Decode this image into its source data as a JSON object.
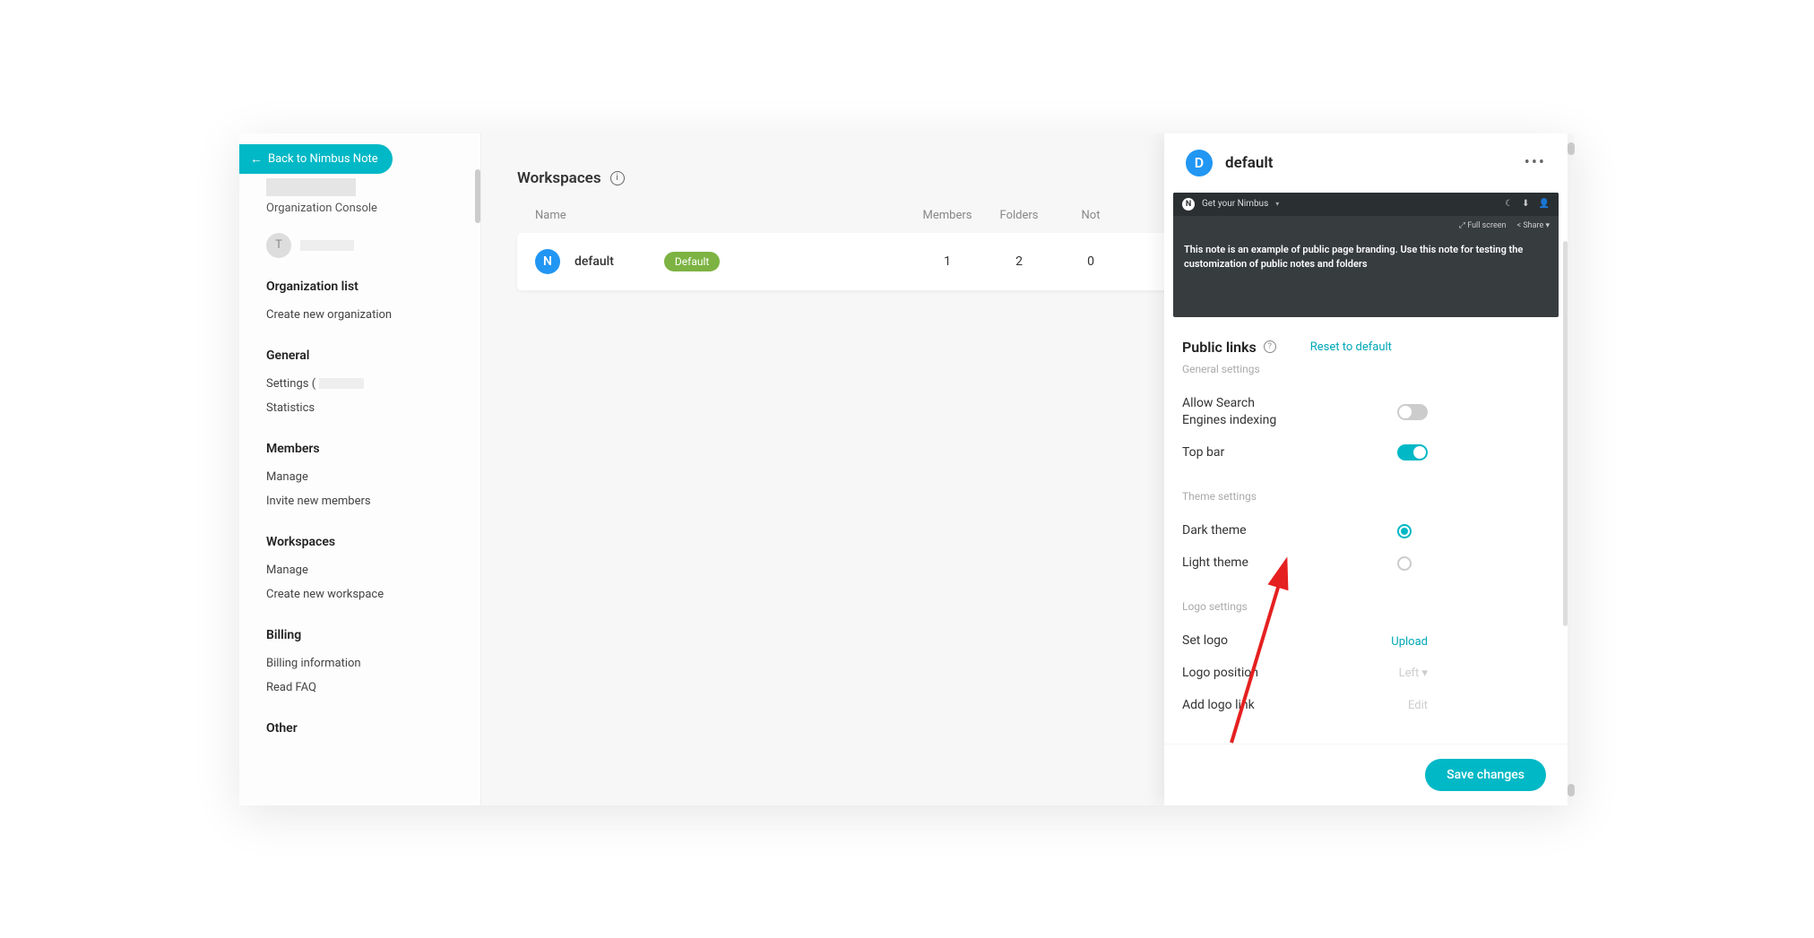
{
  "back_button": "Back to Nimbus Note",
  "sidebar": {
    "console_label": "Organization Console",
    "user_initial": "T",
    "sections": {
      "org_list": {
        "header": "Organization list",
        "items": [
          "Create new organization"
        ]
      },
      "general": {
        "header": "General",
        "items_prefix": "Settings (",
        "items": [
          "Settings (",
          "Statistics"
        ]
      },
      "members": {
        "header": "Members",
        "items": [
          "Manage",
          "Invite new members"
        ]
      },
      "workspaces": {
        "header": "Workspaces",
        "items": [
          "Manage",
          "Create new workspace"
        ]
      },
      "billing": {
        "header": "Billing",
        "items": [
          "Billing information",
          "Read FAQ"
        ]
      },
      "other": {
        "header": "Other"
      }
    }
  },
  "main": {
    "title": "Workspaces",
    "columns": {
      "name": "Name",
      "members": "Members",
      "folders": "Folders",
      "notes": "Not"
    },
    "row": {
      "initial": "N",
      "name": "default",
      "badge": "Default",
      "members": "1",
      "folders": "2",
      "notes": "0"
    }
  },
  "panel": {
    "avatar": "D",
    "title": "default",
    "preview": {
      "brand": "Get your Nimbus",
      "fullscreen": "Full screen",
      "share": "Share",
      "text": "This note is an example of public page branding. Use this note for testing the customization of public notes and folders"
    },
    "public_links": {
      "title": "Public links",
      "reset": "Reset to default",
      "general_heading": "General settings",
      "allow_search": "Allow Search Engines indexing",
      "top_bar": "Top bar",
      "theme_heading": "Theme settings",
      "dark_theme": "Dark theme",
      "light_theme": "Light theme",
      "logo_heading": "Logo settings",
      "set_logo": "Set logo",
      "upload": "Upload",
      "logo_position": "Logo position",
      "position_value": "Left",
      "add_logo_link": "Add logo link",
      "edit": "Edit"
    },
    "save": "Save changes"
  }
}
